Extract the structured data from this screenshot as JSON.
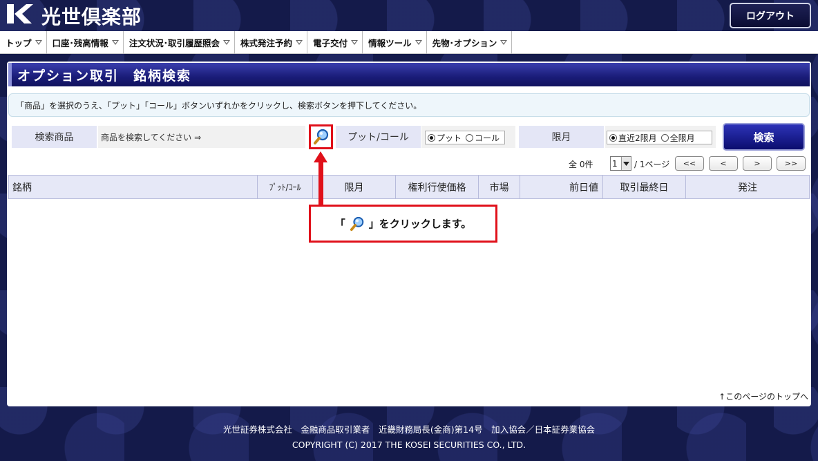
{
  "header": {
    "site_title": "光世倶楽部",
    "logout_label": "ログアウト"
  },
  "nav": {
    "items": [
      {
        "label": "トップ"
      },
      {
        "label": "口座･残高情報"
      },
      {
        "label": "注文状況･取引履歴照会"
      },
      {
        "label": "株式発注予約"
      },
      {
        "label": "電子交付"
      },
      {
        "label": "情報ツール"
      },
      {
        "label": "先物･オプション"
      }
    ]
  },
  "page": {
    "title": "オプション取引　銘柄検索",
    "instruction": "「商品」を選択のうえ、「プット」「コール」ボタンいずれかをクリックし、検索ボタンを押下してください。"
  },
  "search": {
    "product_label": "検索商品",
    "product_placeholder": "商品を検索してください ⇒",
    "putcall_label": "プット/コール",
    "put_option": "プット",
    "call_option": "コール",
    "putcall_selected": "プット",
    "month_label": "限月",
    "month_option_1": "直近2限月",
    "month_option_2": "全限月",
    "month_selected": "直近2限月",
    "search_button": "検索",
    "icon": "magnifier-icon"
  },
  "pager": {
    "total": "全 0件",
    "page_value": "1",
    "page_total": "/ 1ページ",
    "first": "<<",
    "prev": "<",
    "next": ">",
    "last": ">>"
  },
  "table": {
    "headers": [
      "銘柄",
      "ﾌﾟｯﾄ/ｺｰﾙ",
      "限月",
      "権利行使価格",
      "市場",
      "前日値",
      "取引最終日",
      "発注"
    ]
  },
  "annotation": {
    "prefix": "「",
    "suffix": "」をクリックします。",
    "color": "#e0101a"
  },
  "pagetop_link": "↑このページのトップへ",
  "footer": {
    "company_line": "光世証券株式会社　金融商品取引業者　近畿財務局長(金商)第14号　加入協会／日本証券業協会",
    "copyright": "COPYRIGHT (C) 2017 THE KOSEI SECURITIES CO., LTD."
  }
}
